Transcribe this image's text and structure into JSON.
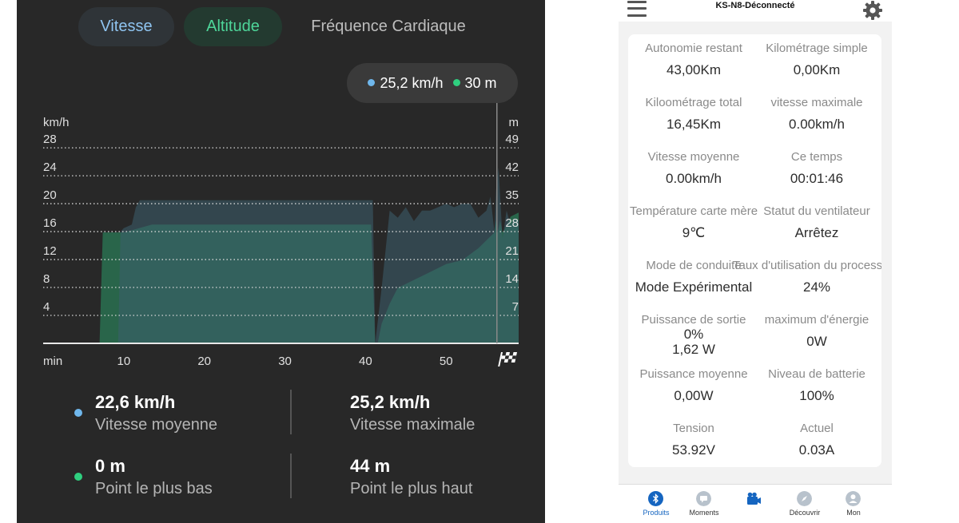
{
  "left_app": {
    "tabs": [
      {
        "label": "Vitesse",
        "active": true
      },
      {
        "label": "Altitude",
        "active": true
      },
      {
        "label": "Fréquence Cardiaque",
        "active": false
      }
    ],
    "tooltip": {
      "speed": "25,2 km/h",
      "altitude": "30 m"
    },
    "stats": [
      {
        "value": "22,6 km/h",
        "label": "Vitesse moyenne"
      },
      {
        "value": "25,2 km/h",
        "label": "Vitesse maximale"
      },
      {
        "value": "0 m",
        "label": "Point le plus bas"
      },
      {
        "value": "44 m",
        "label": "Point le plus haut"
      }
    ],
    "colors": {
      "speed": "#6fb7ec",
      "altitude": "#2fcf7f",
      "background": "#282828"
    }
  },
  "chart_data": {
    "type": "area",
    "xlabel": "min",
    "ylabel_left": "km/h",
    "ylabel_right": "m",
    "x_ticks": [
      "10",
      "20",
      "30",
      "40",
      "50"
    ],
    "x_end_icon": "checkered-flag-icon",
    "left_ticks": [
      "28",
      "24",
      "20",
      "16",
      "12",
      "8",
      "4"
    ],
    "right_ticks": [
      "49",
      "42",
      "35",
      "28",
      "21",
      "14",
      "7"
    ],
    "xlim": [
      0,
      59
    ],
    "ylim_left": [
      0,
      29.5
    ],
    "ylim_right": [
      0,
      52
    ],
    "grid": true,
    "series": [
      {
        "axis": "right",
        "x": [
          7,
          7.4,
          8,
          10,
          13.5,
          16,
          40.7,
          41.2,
          41.5,
          42,
          43,
          44,
          46,
          48,
          50,
          52,
          54,
          55.5,
          56,
          56.2,
          56.4,
          56.7,
          57,
          57.3,
          58,
          59
        ],
        "values": [
          0,
          28,
          28,
          28,
          30,
          30,
          30,
          0,
          0,
          5,
          10,
          14,
          16,
          18,
          20,
          21,
          24,
          27,
          28,
          31,
          28,
          31,
          28,
          29,
          32,
          33
        ]
      },
      {
        "axis": "left",
        "x": [
          7,
          9.3,
          9.6,
          10,
          11,
          11.5,
          12,
          40.9,
          41.2,
          42,
          43,
          44,
          45,
          46,
          47,
          48,
          49,
          50,
          51,
          52,
          53,
          54,
          55,
          55.5,
          56,
          56.2,
          56.5,
          57,
          57.5,
          58,
          58.5,
          59
        ],
        "values": [
          0,
          0,
          16,
          16.5,
          17,
          19.5,
          20.5,
          20.5,
          0,
          8,
          19,
          18,
          19.5,
          17.5,
          19,
          19,
          19.5,
          20,
          19.5,
          20,
          20,
          18,
          19,
          21,
          16,
          22,
          25.2,
          15,
          19,
          17,
          18,
          17.5
        ]
      }
    ]
  },
  "right_app": {
    "header_title": "KS-N8-Déconnecté",
    "cells": [
      {
        "label": "Autonomie restant",
        "value": "43,00Km"
      },
      {
        "label": "Kilométrage simple",
        "value": "0,00Km"
      },
      {
        "label": "Kiloométrage total",
        "value": "16,45Km"
      },
      {
        "label": "vitesse maximale",
        "value": "0.00km/h"
      },
      {
        "label": "Vitesse moyenne",
        "value": "0.00km/h"
      },
      {
        "label": "Ce temps",
        "value": "00:01:46"
      },
      {
        "label": "Température carte mère",
        "value": "9℃"
      },
      {
        "label": "Statut du ventilateur",
        "value": "Arrêtez"
      },
      {
        "label": "Mode de conduite",
        "value": "Mode Expérimental"
      },
      {
        "label": "Taux d'utilisation du processeur",
        "value": "24%"
      },
      {
        "label": "Puissance de sortie",
        "value": "0%",
        "value2": "1,62 W"
      },
      {
        "label": "maximum d'énergie",
        "value": "0W"
      },
      {
        "label": "Puissance moyenne",
        "value": "0,00W"
      },
      {
        "label": "Niveau de batterie",
        "value": "100%"
      },
      {
        "label": "Tension",
        "value": "53.92V"
      },
      {
        "label": "Actuel",
        "value": "0.03A"
      }
    ],
    "nav": [
      {
        "label": "Produits",
        "icon": "bluetooth-icon",
        "active": true
      },
      {
        "label": "Moments",
        "icon": "chat-bubble-icon",
        "active": false
      },
      {
        "label": "",
        "icon": "camera-icon",
        "active": false
      },
      {
        "label": "Découvrir",
        "icon": "compass-icon",
        "active": false
      },
      {
        "label": "Mon",
        "icon": "user-icon",
        "active": false
      }
    ],
    "accent": "#1565c0"
  }
}
